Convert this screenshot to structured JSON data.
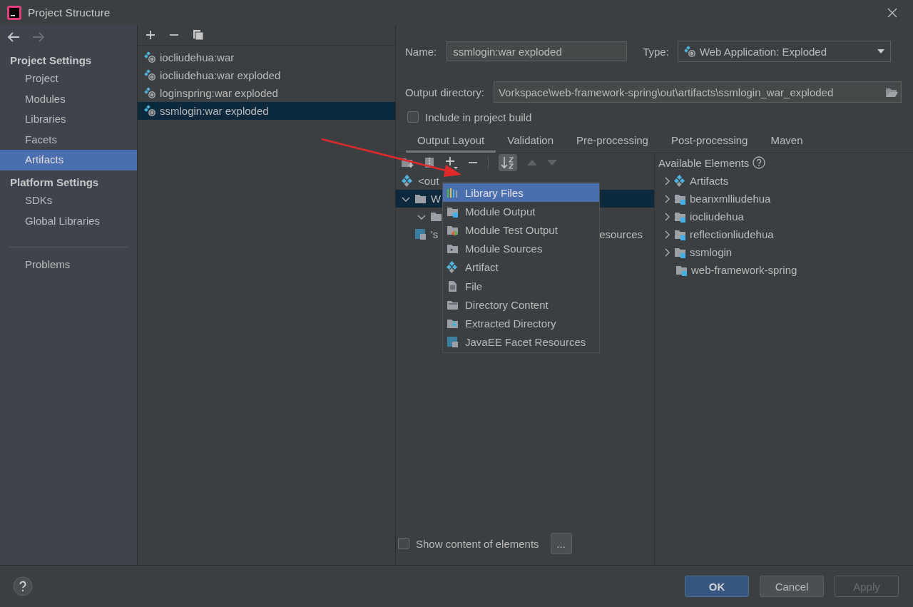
{
  "window": {
    "title": "Project Structure"
  },
  "sidebar": {
    "sections": [
      {
        "heading": "Project Settings",
        "items": [
          {
            "label": "Project",
            "selected": false
          },
          {
            "label": "Modules",
            "selected": false
          },
          {
            "label": "Libraries",
            "selected": false
          },
          {
            "label": "Facets",
            "selected": false
          },
          {
            "label": "Artifacts",
            "selected": true
          }
        ]
      },
      {
        "heading": "Platform Settings",
        "items": [
          {
            "label": "SDKs",
            "selected": false
          },
          {
            "label": "Global Libraries",
            "selected": false
          }
        ]
      }
    ],
    "footer_items": [
      {
        "label": "Problems",
        "selected": false
      }
    ]
  },
  "artifacts": [
    {
      "label": "iocliudehua:war",
      "selected": false
    },
    {
      "label": "iocliudehua:war exploded",
      "selected": false
    },
    {
      "label": "loginspring:war exploded",
      "selected": false
    },
    {
      "label": "ssmlogin:war exploded",
      "selected": true
    }
  ],
  "name_field": {
    "label": "Name:",
    "value": "ssmlogin:war exploded"
  },
  "type_field": {
    "label": "Type:",
    "value": "Web Application: Exploded"
  },
  "output_directory": {
    "label": "Output directory:",
    "value": "Vorkspace\\web-framework-spring\\out\\artifacts\\ssmlogin_war_exploded"
  },
  "include_in_build": {
    "label": "Include in project build",
    "checked": false
  },
  "tabs": [
    {
      "label": "Output Layout",
      "selected": true
    },
    {
      "label": "Validation",
      "selected": false
    },
    {
      "label": "Pre-processing",
      "selected": false
    },
    {
      "label": "Post-processing",
      "selected": false
    },
    {
      "label": "Maven",
      "selected": false
    }
  ],
  "layout_tree": [
    {
      "kind": "artifact",
      "label": "<out",
      "selected": false,
      "expanded": false
    },
    {
      "kind": "folder",
      "label": "W",
      "selected": true,
      "expanded": true
    },
    {
      "kind": "folder",
      "selected": false,
      "expanded": true
    },
    {
      "kind": "facet",
      "label": "'s",
      "tail": "esources",
      "selected": false,
      "expanded": false
    }
  ],
  "available_elements": {
    "title": "Available Elements",
    "items": [
      {
        "kind": "artifact",
        "label": "Artifacts",
        "expandable": true
      },
      {
        "kind": "module",
        "label": "beanxmlliudehua",
        "expandable": true
      },
      {
        "kind": "module",
        "label": "iocliudehua",
        "expandable": true
      },
      {
        "kind": "module",
        "label": "reflectionliudehua",
        "expandable": true
      },
      {
        "kind": "module",
        "label": "ssmlogin",
        "expandable": true
      },
      {
        "kind": "module",
        "label": "web-framework-spring",
        "expandable": false
      }
    ]
  },
  "add_menu": [
    {
      "kind": "library",
      "label": "Library Files",
      "selected": true
    },
    {
      "kind": "module-output",
      "label": "Module Output",
      "selected": false
    },
    {
      "kind": "test-output",
      "label": "Module Test Output",
      "selected": false
    },
    {
      "kind": "sources",
      "label": "Module Sources",
      "selected": false
    },
    {
      "kind": "artifact",
      "label": "Artifact",
      "selected": false
    },
    {
      "kind": "file",
      "label": "File",
      "selected": false
    },
    {
      "kind": "directory",
      "label": "Directory Content",
      "selected": false
    },
    {
      "kind": "extracted",
      "label": "Extracted Directory",
      "selected": false
    },
    {
      "kind": "facet",
      "label": "JavaEE Facet Resources",
      "selected": false
    }
  ],
  "show_content": {
    "label": "Show content of elements",
    "checked": false,
    "button": "..."
  },
  "buttons": [
    {
      "label": "OK",
      "kind": "primary",
      "disabled": false
    },
    {
      "label": "Cancel",
      "kind": "normal",
      "disabled": false
    },
    {
      "label": "Apply",
      "kind": "normal",
      "disabled": true
    }
  ],
  "annotations": [
    {
      "kind": "arrow"
    }
  ]
}
